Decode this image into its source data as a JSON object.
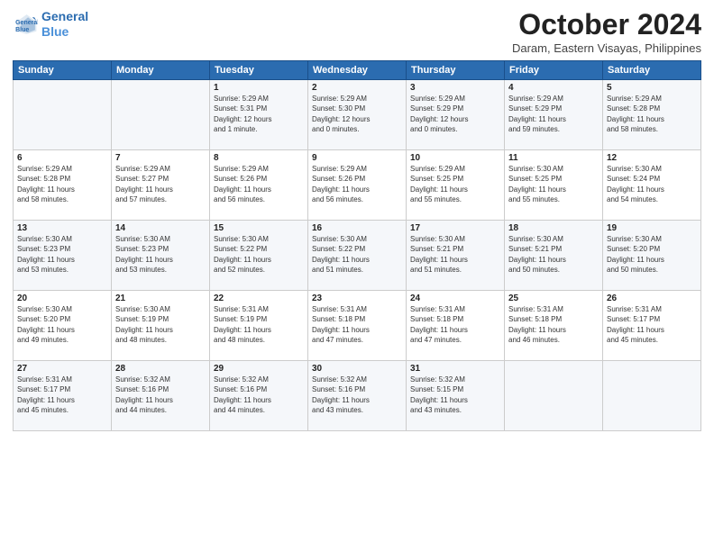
{
  "logo": {
    "line1": "General",
    "line2": "Blue"
  },
  "title": "October 2024",
  "location": "Daram, Eastern Visayas, Philippines",
  "header": {
    "days": [
      "Sunday",
      "Monday",
      "Tuesday",
      "Wednesday",
      "Thursday",
      "Friday",
      "Saturday"
    ]
  },
  "weeks": [
    [
      {
        "day": "",
        "info": ""
      },
      {
        "day": "",
        "info": ""
      },
      {
        "day": "1",
        "info": "Sunrise: 5:29 AM\nSunset: 5:31 PM\nDaylight: 12 hours\nand 1 minute."
      },
      {
        "day": "2",
        "info": "Sunrise: 5:29 AM\nSunset: 5:30 PM\nDaylight: 12 hours\nand 0 minutes."
      },
      {
        "day": "3",
        "info": "Sunrise: 5:29 AM\nSunset: 5:29 PM\nDaylight: 12 hours\nand 0 minutes."
      },
      {
        "day": "4",
        "info": "Sunrise: 5:29 AM\nSunset: 5:29 PM\nDaylight: 11 hours\nand 59 minutes."
      },
      {
        "day": "5",
        "info": "Sunrise: 5:29 AM\nSunset: 5:28 PM\nDaylight: 11 hours\nand 58 minutes."
      }
    ],
    [
      {
        "day": "6",
        "info": "Sunrise: 5:29 AM\nSunset: 5:28 PM\nDaylight: 11 hours\nand 58 minutes."
      },
      {
        "day": "7",
        "info": "Sunrise: 5:29 AM\nSunset: 5:27 PM\nDaylight: 11 hours\nand 57 minutes."
      },
      {
        "day": "8",
        "info": "Sunrise: 5:29 AM\nSunset: 5:26 PM\nDaylight: 11 hours\nand 56 minutes."
      },
      {
        "day": "9",
        "info": "Sunrise: 5:29 AM\nSunset: 5:26 PM\nDaylight: 11 hours\nand 56 minutes."
      },
      {
        "day": "10",
        "info": "Sunrise: 5:29 AM\nSunset: 5:25 PM\nDaylight: 11 hours\nand 55 minutes."
      },
      {
        "day": "11",
        "info": "Sunrise: 5:30 AM\nSunset: 5:25 PM\nDaylight: 11 hours\nand 55 minutes."
      },
      {
        "day": "12",
        "info": "Sunrise: 5:30 AM\nSunset: 5:24 PM\nDaylight: 11 hours\nand 54 minutes."
      }
    ],
    [
      {
        "day": "13",
        "info": "Sunrise: 5:30 AM\nSunset: 5:23 PM\nDaylight: 11 hours\nand 53 minutes."
      },
      {
        "day": "14",
        "info": "Sunrise: 5:30 AM\nSunset: 5:23 PM\nDaylight: 11 hours\nand 53 minutes."
      },
      {
        "day": "15",
        "info": "Sunrise: 5:30 AM\nSunset: 5:22 PM\nDaylight: 11 hours\nand 52 minutes."
      },
      {
        "day": "16",
        "info": "Sunrise: 5:30 AM\nSunset: 5:22 PM\nDaylight: 11 hours\nand 51 minutes."
      },
      {
        "day": "17",
        "info": "Sunrise: 5:30 AM\nSunset: 5:21 PM\nDaylight: 11 hours\nand 51 minutes."
      },
      {
        "day": "18",
        "info": "Sunrise: 5:30 AM\nSunset: 5:21 PM\nDaylight: 11 hours\nand 50 minutes."
      },
      {
        "day": "19",
        "info": "Sunrise: 5:30 AM\nSunset: 5:20 PM\nDaylight: 11 hours\nand 50 minutes."
      }
    ],
    [
      {
        "day": "20",
        "info": "Sunrise: 5:30 AM\nSunset: 5:20 PM\nDaylight: 11 hours\nand 49 minutes."
      },
      {
        "day": "21",
        "info": "Sunrise: 5:30 AM\nSunset: 5:19 PM\nDaylight: 11 hours\nand 48 minutes."
      },
      {
        "day": "22",
        "info": "Sunrise: 5:31 AM\nSunset: 5:19 PM\nDaylight: 11 hours\nand 48 minutes."
      },
      {
        "day": "23",
        "info": "Sunrise: 5:31 AM\nSunset: 5:18 PM\nDaylight: 11 hours\nand 47 minutes."
      },
      {
        "day": "24",
        "info": "Sunrise: 5:31 AM\nSunset: 5:18 PM\nDaylight: 11 hours\nand 47 minutes."
      },
      {
        "day": "25",
        "info": "Sunrise: 5:31 AM\nSunset: 5:18 PM\nDaylight: 11 hours\nand 46 minutes."
      },
      {
        "day": "26",
        "info": "Sunrise: 5:31 AM\nSunset: 5:17 PM\nDaylight: 11 hours\nand 45 minutes."
      }
    ],
    [
      {
        "day": "27",
        "info": "Sunrise: 5:31 AM\nSunset: 5:17 PM\nDaylight: 11 hours\nand 45 minutes."
      },
      {
        "day": "28",
        "info": "Sunrise: 5:32 AM\nSunset: 5:16 PM\nDaylight: 11 hours\nand 44 minutes."
      },
      {
        "day": "29",
        "info": "Sunrise: 5:32 AM\nSunset: 5:16 PM\nDaylight: 11 hours\nand 44 minutes."
      },
      {
        "day": "30",
        "info": "Sunrise: 5:32 AM\nSunset: 5:16 PM\nDaylight: 11 hours\nand 43 minutes."
      },
      {
        "day": "31",
        "info": "Sunrise: 5:32 AM\nSunset: 5:15 PM\nDaylight: 11 hours\nand 43 minutes."
      },
      {
        "day": "",
        "info": ""
      },
      {
        "day": "",
        "info": ""
      }
    ]
  ]
}
